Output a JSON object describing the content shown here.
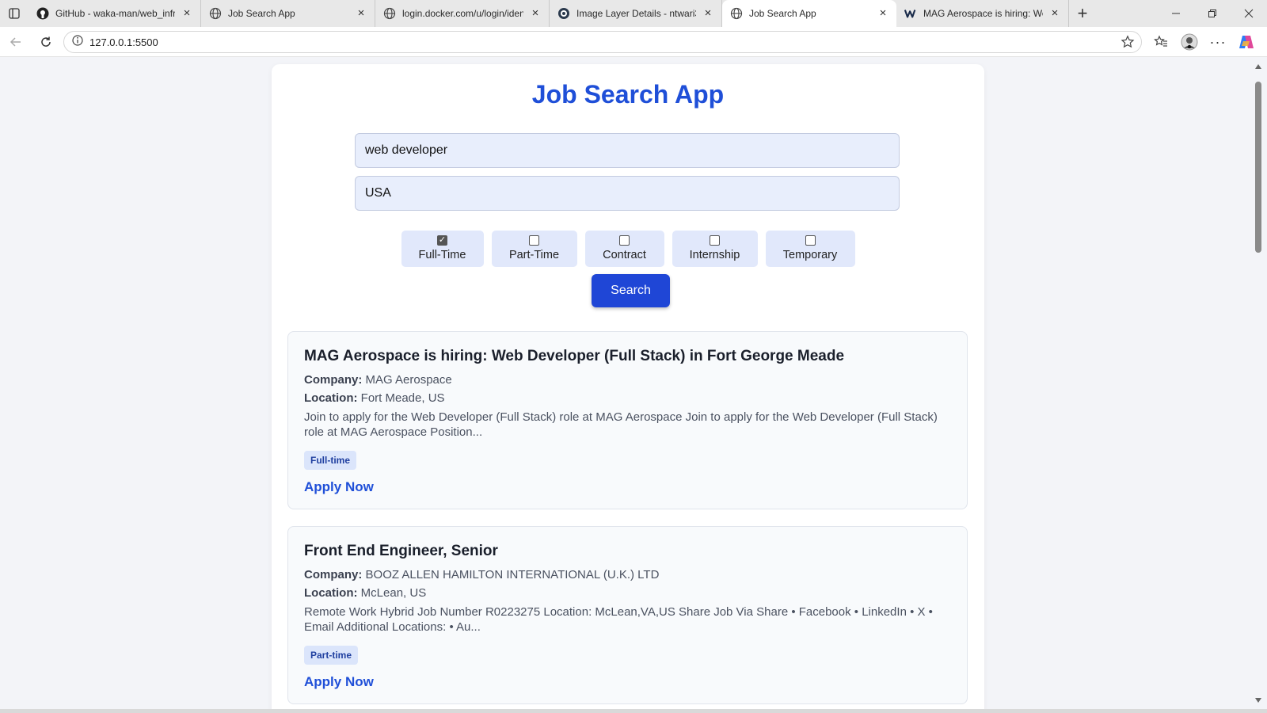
{
  "browser": {
    "tabs": [
      {
        "title": "GitHub - waka-man/web_infra",
        "icon": "github-icon"
      },
      {
        "title": "Job Search App",
        "icon": "globe-icon"
      },
      {
        "title": "login.docker.com/u/login/iden",
        "icon": "globe-icon"
      },
      {
        "title": "Image Layer Details - ntwari30",
        "icon": "docker-icon"
      },
      {
        "title": "Job Search App",
        "icon": "globe-icon",
        "active": true
      },
      {
        "title": "MAG Aerospace is hiring: Web",
        "icon": "workable-icon"
      }
    ],
    "url": "127.0.0.1:5500"
  },
  "app": {
    "title": "Job Search App",
    "accent_color": "#1f4fd8",
    "search": {
      "query_value": "web developer",
      "location_value": "USA"
    },
    "filters": [
      {
        "label": "Full-Time",
        "checked": true
      },
      {
        "label": "Part-Time",
        "checked": false
      },
      {
        "label": "Contract",
        "checked": false
      },
      {
        "label": "Internship",
        "checked": false
      },
      {
        "label": "Temporary",
        "checked": false
      }
    ],
    "search_button_label": "Search",
    "labels": {
      "company": "Company:",
      "location": "Location:",
      "apply": "Apply Now"
    },
    "jobs": [
      {
        "title": "MAG Aerospace is hiring: Web Developer (Full Stack) in Fort George Meade",
        "company": "MAG Aerospace",
        "location": "Fort Meade, US",
        "description": "Join to apply for the Web Developer (Full Stack) role at MAG Aerospace Join to apply for the Web Developer (Full Stack) role at MAG Aerospace Position...",
        "type": "Full-time"
      },
      {
        "title": "Front End Engineer, Senior",
        "company": "BOOZ ALLEN HAMILTON INTERNATIONAL (U.K.) LTD",
        "location": "McLean, US",
        "description": "Remote Work Hybrid Job Number R0223275 Location: McLean,VA,US Share Job Via Share • Facebook • LinkedIn • X • Email Additional Locations: • Au...",
        "type": "Part-time"
      }
    ]
  }
}
